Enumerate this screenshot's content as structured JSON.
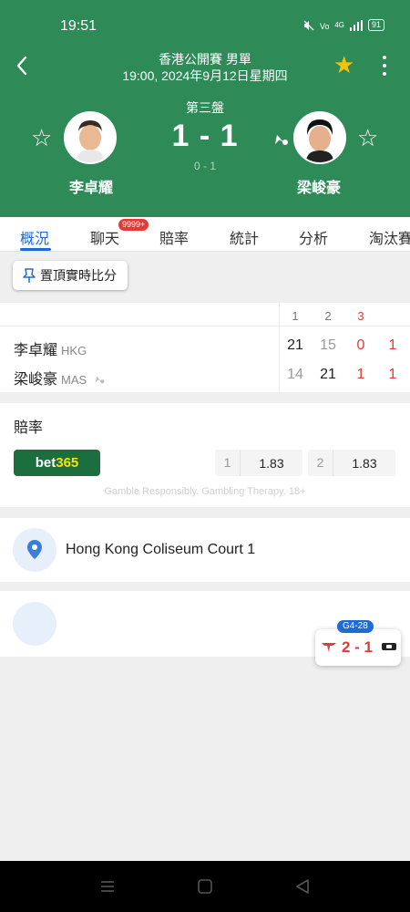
{
  "status_bar": {
    "time": "19:51",
    "battery": "91",
    "signal_label": "4G"
  },
  "header": {
    "tournament": "香港公開賽 男單",
    "datetime": "19:00, 2024年9月12日星期四",
    "set_label": "第三盤",
    "score": "1 - 1",
    "game_score": "0 - 1",
    "colors": {
      "background": "#2e8b57",
      "favorite": "#f4c20d"
    }
  },
  "players": {
    "home": {
      "name": "李卓耀",
      "country": "HKG"
    },
    "away": {
      "name": "梁峻豪",
      "country": "MAS"
    }
  },
  "tabs": [
    {
      "label": "概況",
      "active": true
    },
    {
      "label": "聊天",
      "badge": "9999+"
    },
    {
      "label": "賠率"
    },
    {
      "label": "統計"
    },
    {
      "label": "分析"
    },
    {
      "label": "淘汰賽"
    }
  ],
  "pin_button": {
    "label": "置頂實時比分"
  },
  "score_table": {
    "columns": [
      "1",
      "2",
      "3"
    ],
    "rows": [
      {
        "name": "李卓耀",
        "country": "HKG",
        "sets": [
          "21",
          "15",
          "0"
        ],
        "total": "1"
      },
      {
        "name": "梁峻豪",
        "country": "MAS",
        "sets": [
          "14",
          "21",
          "1"
        ],
        "total": "1"
      }
    ]
  },
  "odds": {
    "title": "賠率",
    "bookmaker": {
      "name_part1": "bet",
      "name_part2": "365"
    },
    "options": [
      {
        "index": "1",
        "value": "1.83"
      },
      {
        "index": "2",
        "value": "1.83"
      }
    ],
    "disclaimer": "Gamble Responsibly. Gambling Therapy. 18+"
  },
  "venue": {
    "name": "Hong Kong Coliseum Court 1"
  },
  "float_widget": {
    "tag": "G4-28",
    "score": "2 - 1"
  }
}
